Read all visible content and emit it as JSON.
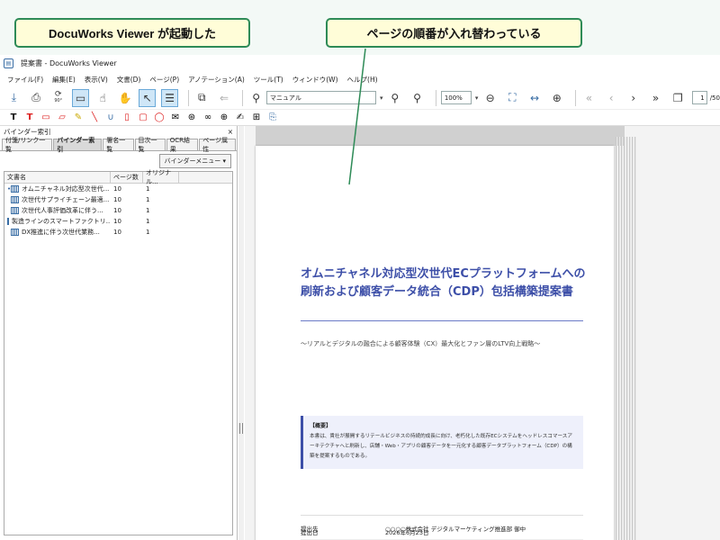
{
  "callouts": {
    "left": "DocuWorks Viewer が起動した",
    "right": "ページの順番が入れ替わっている"
  },
  "window": {
    "title": "提案書 - DocuWorks Viewer"
  },
  "menu": [
    "ファイル(F)",
    "編集(E)",
    "表示(V)",
    "文書(D)",
    "ページ(P)",
    "アノテーション(A)",
    "ツール(T)",
    "ウィンドウ(W)",
    "ヘルプ(H)"
  ],
  "toolbar": {
    "search_value": "マニュアル",
    "zoom_value": "100%",
    "rotate_label": "90°",
    "page_current": "1",
    "page_total": "/50"
  },
  "left_pane": {
    "title": "バインダー索引",
    "close_glyph": "×",
    "tabs": [
      "付箋/リンク一覧",
      "バインダー索引",
      "署名一覧",
      "目次一覧",
      "OCR結果",
      "ページ属性"
    ],
    "active_tab": 1,
    "binder_menu": "バインダーメニュー",
    "columns": [
      "文書名",
      "ページ数",
      "オリジナル..."
    ],
    "rows": [
      {
        "name": "オムニチャネル対応型次世代...",
        "pages": "10",
        "orig": "1"
      },
      {
        "name": "次世代サプライチェーン最適...",
        "pages": "10",
        "orig": "1"
      },
      {
        "name": "次世代人事評価改革に伴う...",
        "pages": "10",
        "orig": "1"
      },
      {
        "name": "製造ラインのスマートファクトリ...",
        "pages": "10",
        "orig": "1"
      },
      {
        "name": "DX推進に伴う次世代業務...",
        "pages": "10",
        "orig": "1"
      }
    ]
  },
  "document": {
    "title": "オムニチャネル対応型次世代ECプラットフォームへの刷新および顧客データ統合（CDP）包括構築提案書",
    "subtitle": "～リアルとデジタルの融合による顧客体験（CX）最大化とファン層のLTV向上戦略～",
    "summary_head": "【概要】",
    "summary_body": "本書は、貴社が展開するリテールビジネスの持続的成長に向け、老朽化した既存ECシステムをヘッドレスコマースアーキテクチャへと刷新し、店舗・Web・アプリの顧客データを一元化する顧客データプラットフォーム（CDP）の構築を提案するものである。",
    "info": [
      {
        "k": "提出日",
        "v": "2026年6月23日"
      },
      {
        "k": "提出先",
        "v": "○○○○株式会社 デジタルマーケティング推進部 御中"
      }
    ]
  }
}
